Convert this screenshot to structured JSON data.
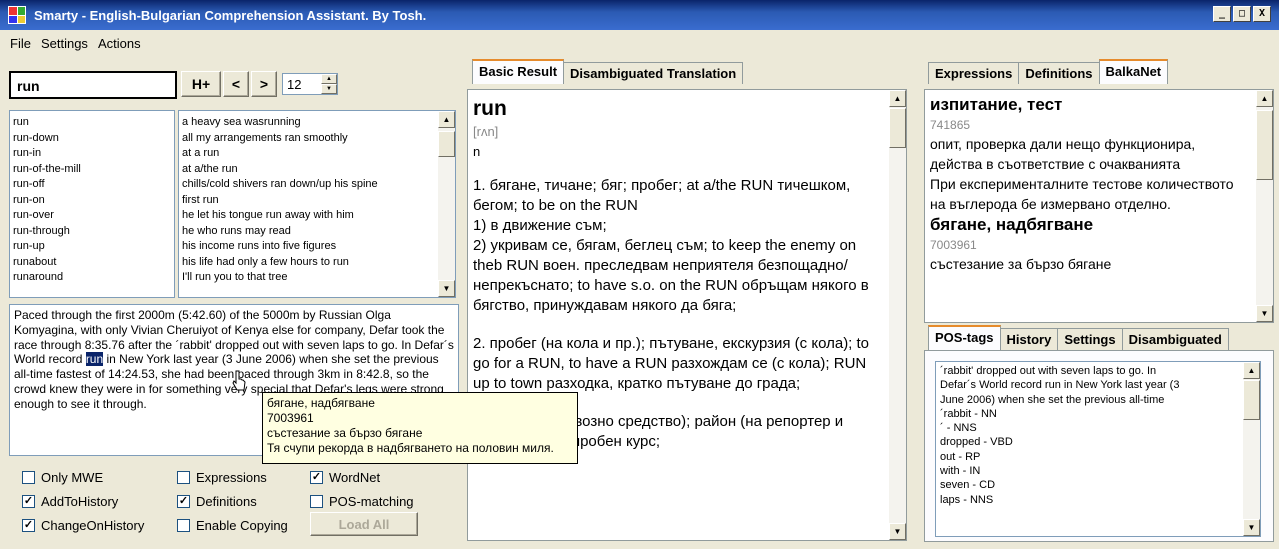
{
  "window": {
    "title": "Smarty - English-Bulgarian Comprehension Assistant. By Tosh.",
    "min_glyph": "_",
    "max_glyph": "□",
    "close_glyph": "X"
  },
  "menu": [
    "File",
    "Settings",
    "Actions"
  ],
  "search": {
    "value": "run",
    "hplus_label": "H+",
    "prev_label": "<",
    "next_label": ">",
    "count_value": "12"
  },
  "word_list": [
    "run",
    "run-down",
    "run-in",
    "run-of-the-mill",
    "run-off",
    "run-on",
    "run-over",
    "run-through",
    "run-up",
    "runabout",
    "runaround"
  ],
  "phrase_list": [
    "a heavy sea wasrunning",
    "all my arrangements ran smoothly",
    "at a run",
    "at a/the run",
    "chills/cold shivers ran down/up his spine",
    "first run",
    "he let his tongue run away with him",
    "he who runs may read",
    "his income runs into five figures",
    "his life had only a few hours to run",
    "I'll run you to that tree"
  ],
  "paragraph": {
    "before": "Paced through the first 2000m (5:42.60) of the 5000m by Russian Olga Komyagina, with only Vivian Cheruiyot of Kenya else for company, Defar took the race through 8:35.76 after the ´rabbit' dropped out with seven laps to go. In Defar´s World record ",
    "highlight": "run",
    "after": " in New York last year (3 June 2006) when she set the previous all-time fastest of 14:24.53, she had been paced through 3km in 8:42.8, so the crowd knew they were in for something very special that Defar's legs were strong enough to see it through."
  },
  "tooltip": {
    "line1": "бягане, надбягване",
    "line2": "7003961",
    "line3": "състезание за бързо бягане",
    "line4": "Тя счупи рекорда в надбягването на половин миля."
  },
  "options": {
    "only_mwe": {
      "label": "Only MWE",
      "checked": ""
    },
    "add_to_history": {
      "label": "AddToHistory",
      "checked": "✓"
    },
    "change_on_history": {
      "label": "ChangeOnHistory",
      "checked": "✓"
    },
    "expressions": {
      "label": "Expressions",
      "checked": ""
    },
    "definitions": {
      "label": "Definitions",
      "checked": "✓"
    },
    "enable_copying": {
      "label": "Enable Copying",
      "checked": ""
    },
    "wordnet": {
      "label": "WordNet",
      "checked": "✓"
    },
    "pos_matching": {
      "label": "POS-matching",
      "checked": ""
    },
    "load_all": "Load All"
  },
  "middle_tabs": [
    "Basic Result",
    "Disambiguated Translation"
  ],
  "result": {
    "word": "run",
    "transcription": "[rʌn]",
    "pos": "n",
    "defs": [
      "1. бягане, тичане; бяг; пробег; at a/the RUN тичешком, бегом; to be on the RUN",
      "1) в движение съм;",
      "2) укривам се, бягам, беглец съм; to keep the enemy on theb RUN воен. преследвам неприятеля безпощадно/непрекъснато; to have s.o. on the RUN обръщам някого в бягство, принуждавам някого да бяга;",
      "2. пробег (на кола и пр.); пътуване, екскурзия (с кола); to go for a RUN, to have a RUN разхождам се (с кола); RUN up to town разходка, кратко пътуване до града;",
      "3. курс (на превозно средство); район (на репортер и пр.); trial RUN пробен курс;"
    ]
  },
  "right_top_tabs": [
    "Expressions",
    "Definitions",
    "BalkaNet"
  ],
  "balkanet": {
    "head1": "изпитание, тест",
    "id1": "741865",
    "def1": "опит, проверка дали нещо функционира, действа в съответствие с очакванията",
    "ex1": "При експерименталните тестове количеството на въглерода бе измервано отделно.",
    "head2": "бягане, надбягване",
    "id2": "7003961",
    "def2": "състезание за бързо бягане"
  },
  "right_bottom_tabs": [
    "POS-tags",
    "History",
    "Settings",
    "Disambiguated"
  ],
  "pos_tags": [
    "´rabbit' dropped out with seven laps to go. In",
    "Defar´s World record run in New York last year (3",
    "June 2006) when she set the previous all-time",
    "´rabbit - NN",
    "´ - NNS",
    "dropped - VBD",
    "out - RP",
    "with - IN",
    "seven - CD",
    "laps - NNS"
  ]
}
